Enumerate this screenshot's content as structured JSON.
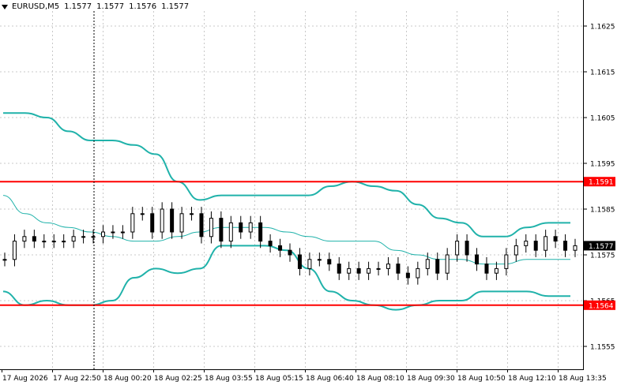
{
  "window": {
    "symbol": "EURUSD,M5",
    "ohlc": [
      "1.1577",
      "1.1577",
      "1.1576",
      "1.1577"
    ]
  },
  "colors": {
    "background": "#ffffff",
    "grid": "#c8c8c8",
    "candle": "#000000",
    "bands": "#20b2aa",
    "ma": "#20b2aa",
    "level_lines": "#ff0000",
    "price_label_bg": "#ff0000",
    "current_label_bg": "#000000"
  },
  "chart_data": {
    "type": "candlestick",
    "y_axis_ticks": [
      "1.1625",
      "1.1615",
      "1.1605",
      "1.1595",
      "1.1585",
      "1.1575",
      "1.1565",
      "1.1555"
    ],
    "x_axis_ticks": [
      "17 Aug 2026",
      "17 Aug 22:50",
      "18 Aug 00:20",
      "18 Aug 02:25",
      "18 Aug 03:55",
      "18 Aug 05:15",
      "18 Aug 06:40",
      "18 Aug 08:10",
      "18 Aug 09:30",
      "18 Aug 10:50",
      "18 Aug 12:10",
      "18 Aug 13:35"
    ],
    "ylim": [
      1.1549,
      1.1631
    ],
    "horizontal_levels": [
      "1.1591",
      "1.1564"
    ],
    "current_price": "1.1577",
    "crosshair_time": "17 Aug 22:50",
    "grid": true,
    "indicators": [
      "Bollinger Bands",
      "Moving Average"
    ],
    "bands_upper": [
      1.1606,
      1.1606,
      1.1605,
      1.1602,
      1.16,
      1.16,
      1.1599,
      1.1597,
      1.1591,
      1.1587,
      1.1588,
      1.1588,
      1.1588,
      1.1588,
      1.1588,
      1.159,
      1.1591,
      1.159,
      1.1589,
      1.1586,
      1.1583,
      1.1582,
      1.1579,
      1.1579,
      1.1581,
      1.1582,
      1.1582
    ],
    "bands_lower": [
      1.1567,
      1.1564,
      1.1565,
      1.1564,
      1.1564,
      1.1565,
      1.157,
      1.1572,
      1.1571,
      1.1572,
      1.1577,
      1.1577,
      1.1577,
      1.1576,
      1.1572,
      1.1567,
      1.1565,
      1.1564,
      1.1563,
      1.1564,
      1.1565,
      1.1565,
      1.1567,
      1.1567,
      1.1567,
      1.1566,
      1.1566
    ],
    "ma": [
      1.1588,
      1.1584,
      1.1582,
      1.1581,
      1.158,
      1.1579,
      1.1578,
      1.1578,
      1.1579,
      1.158,
      1.1581,
      1.1581,
      1.1581,
      1.158,
      1.1579,
      1.1578,
      1.1578,
      1.1578,
      1.1576,
      1.1575,
      1.1574,
      1.1574,
      1.1573,
      1.1573,
      1.1574,
      1.1574,
      1.1574
    ],
    "close": [
      1.1574,
      1.1578,
      1.1579,
      1.1578,
      1.1578,
      1.1578,
      1.1578,
      1.1579,
      1.1579,
      1.1579,
      1.158,
      1.158,
      1.158,
      1.1584,
      1.1584,
      1.158,
      1.1585,
      1.158,
      1.1584,
      1.1584,
      1.1579,
      1.1583,
      1.1578,
      1.1582,
      1.158,
      1.1582,
      1.1578,
      1.1577,
      1.1576,
      1.1575,
      1.1572,
      1.1574,
      1.1574,
      1.1573,
      1.1571,
      1.1572,
      1.1571,
      1.1572,
      1.1572,
      1.1573,
      1.1571,
      1.157,
      1.1572,
      1.1574,
      1.1571,
      1.1575,
      1.1578,
      1.1575,
      1.1573,
      1.1571,
      1.1572,
      1.1575,
      1.1577,
      1.1578,
      1.1576,
      1.1579,
      1.1578,
      1.1576,
      1.1577
    ]
  },
  "price_labels": {
    "level_high": "1.1591",
    "level_low": "1.1564",
    "current": "1.1577"
  }
}
